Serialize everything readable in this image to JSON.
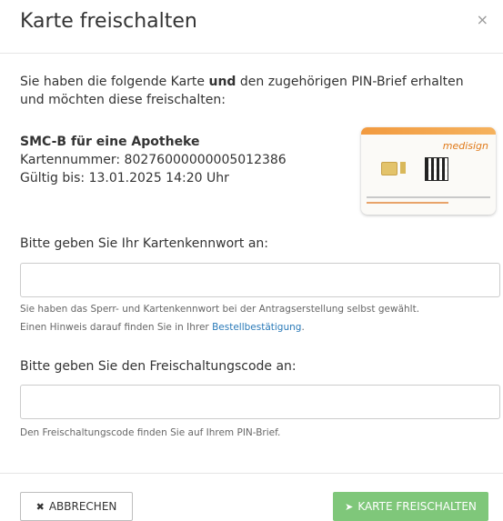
{
  "dialog": {
    "title": "Karte freischalten",
    "close_symbol": "×"
  },
  "intro": {
    "part1": "Sie haben die folgende Karte ",
    "bold": "und",
    "part2": " den zugehörigen PIN-Brief erhalten und möchten diese freischalten:"
  },
  "card": {
    "name": "SMC-B für eine Apotheke",
    "number_line": "Kartennummer: 80276000000005012386",
    "valid_line": "Gültig bis: 13.01.2025 14:20 Uhr",
    "brand": "medisign",
    "image_icon": "card-image"
  },
  "password": {
    "label": "Bitte geben Sie Ihr Kartenkennwort an:",
    "value": "",
    "placeholder": "",
    "help_line1": "Sie haben das Sperr- und Kartenkennwort bei der Antragserstellung selbst gewählt.",
    "help_line2_prefix": "Einen Hinweis darauf finden Sie in Ihrer ",
    "help_link": "Bestellbestätigung",
    "help_line2_suffix": "."
  },
  "code": {
    "label": "Bitte geben Sie den Freischaltungscode an:",
    "value": "",
    "placeholder": "",
    "help": "Den Freischaltungscode finden Sie auf Ihrem PIN-Brief."
  },
  "buttons": {
    "cancel_label": "ABBRECHEN",
    "cancel_icon": "times-icon",
    "submit_label": "KARTE FREISCHALTEN",
    "submit_icon": "paper-plane-icon"
  },
  "colors": {
    "accent_green": "#7fc77a",
    "link_blue": "#2a7ab8"
  }
}
